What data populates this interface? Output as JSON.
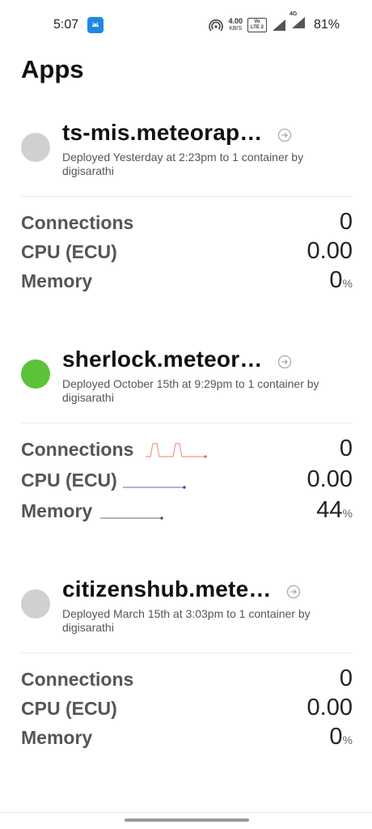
{
  "status_bar": {
    "time": "5:07",
    "netspeed_value": "4.00",
    "netspeed_unit": "KB/S",
    "volte_line1": "Vo",
    "volte_line2": "LTE 2",
    "network_type": "4G",
    "battery": "81%",
    "notification_app_color": "#1e88e5"
  },
  "page": {
    "title": "Apps"
  },
  "apps": [
    {
      "name": "ts-mis.meteorap…",
      "status_color": "#d0d0d0",
      "deployed": "Deployed Yesterday at 2:23pm to 1 container by digisarathi",
      "metrics": {
        "connections_label": "Connections",
        "connections_value": "0",
        "cpu_label": "CPU (ECU)",
        "cpu_value": "0.00",
        "memory_label": "Memory",
        "memory_value": "0",
        "memory_unit": "%"
      }
    },
    {
      "name": "sherlock.meteor…",
      "status_color": "#5cc23a",
      "deployed": "Deployed October 15th at 9:29pm to 1 container by digisarathi",
      "metrics": {
        "connections_label": "Connections",
        "connections_value": "0",
        "cpu_label": "CPU (ECU)",
        "cpu_value": "0.00",
        "memory_label": "Memory",
        "memory_value": "44",
        "memory_unit": "%"
      },
      "sparklines": {
        "connections_color": "#e8704a",
        "cpu_color": "#4050c8",
        "memory_color": "#555566"
      }
    },
    {
      "name": "citizenshub.mete…",
      "status_color": "#d0d0d0",
      "deployed": "Deployed March 15th at 3:03pm to 1 container by digisarathi",
      "metrics": {
        "connections_label": "Connections",
        "connections_value": "0",
        "cpu_label": "CPU (ECU)",
        "cpu_value": "0.00",
        "memory_label": "Memory",
        "memory_value": "0",
        "memory_unit": "%"
      }
    }
  ]
}
